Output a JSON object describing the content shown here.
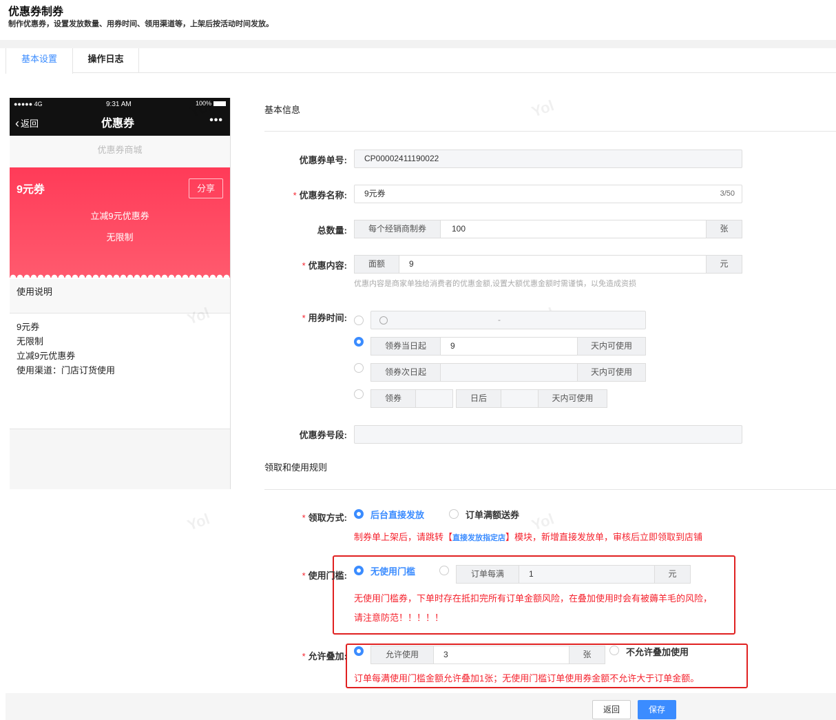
{
  "page": {
    "title": "优惠券制券",
    "subtitle": "制作优惠券，设置发放数量、用券时间、领用渠道等，上架后按活动时间发放。"
  },
  "tabs": [
    {
      "label": "基本设置"
    },
    {
      "label": "操作日志"
    }
  ],
  "phone": {
    "status_left": "●●●●● 4G",
    "status_time": "9:31 AM",
    "status_battery": "100%",
    "back_label": "返回",
    "nav_title": "优惠券",
    "more_label": "•••",
    "mall_label": "优惠券商城",
    "coupon_name": "9元券",
    "share_label": "分享",
    "coupon_desc": "立减9元优惠券",
    "coupon_limit": "无限制",
    "usage_title": "使用说明",
    "usage_lines": [
      "9元券",
      "无限制",
      "立减9元优惠券",
      "使用渠道：门店订货使用"
    ]
  },
  "form": {
    "section_basic": "基本信息",
    "coupon_no": {
      "label": "优惠券单号:",
      "value": "CP00002411190022"
    },
    "coupon_name": {
      "label": "优惠券名称:",
      "value": "9元券",
      "counter": "3/50"
    },
    "total": {
      "label": "总数量:",
      "prefix": "每个经销商制券",
      "value": "100",
      "suffix": "张"
    },
    "content": {
      "label": "优惠内容:",
      "prefix": "面额",
      "value": "9",
      "suffix": "元",
      "hint": "优惠内容是商家单独给消费者的优惠金额,设置大额优惠金额时需谨慎，以免造成资损"
    },
    "use_time": {
      "label": "用券时间:",
      "range_separator": "-",
      "opt2_prefix": "领券当日起",
      "opt2_value": "9",
      "opt2_suffix": "天内可使用",
      "opt3_prefix": "领券次日起",
      "opt3_suffix": "天内可使用",
      "opt4_prefix": "领券",
      "opt4_mid": "日后",
      "opt4_suffix": "天内可使用"
    },
    "coupon_segment": {
      "label": "优惠券号段:",
      "value": ""
    },
    "section_rules": "领取和使用规则",
    "claim_method": {
      "label": "领取方式:",
      "opt1": "后台直接发放",
      "opt2": "订单满额送券",
      "notice_pre": "制券单上架后，请跳转【",
      "notice_link": "直接发放指定店",
      "notice_post": "】模块，新增直接发放单，审核后立即领取到店铺"
    },
    "threshold": {
      "label": "使用门槛:",
      "opt1": "无使用门槛",
      "prefix": "订单每满",
      "value": "1",
      "suffix": "元",
      "warn_line1": "无使用门槛券，下单时存在抵扣完所有订单金额风险，在叠加使用时会有被薅羊毛的风险，",
      "warn_line2": "请注意防范！！！！！"
    },
    "stack": {
      "label": "允许叠加:",
      "prefix": "允许使用",
      "value": "3",
      "suffix": "张",
      "opt2": "不允许叠加使用",
      "warn": "订单每满使用门槛金额允许叠加1张；无使用门槛订单使用券金额不允许大于订单金额。"
    }
  },
  "buttons": {
    "back": "返回",
    "save": "保存"
  },
  "watermark": "Yol",
  "colors": {
    "accent": "#3b8cff",
    "danger": "#f5222d",
    "coupon": "#ff4560"
  }
}
